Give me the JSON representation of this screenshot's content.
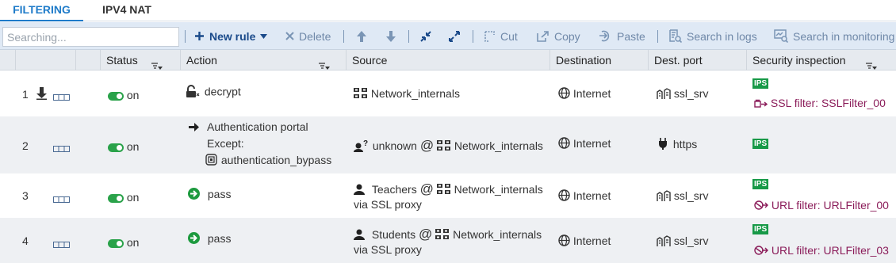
{
  "tabs": [
    {
      "label": "FILTERING",
      "active": true
    },
    {
      "label": "IPV4 NAT",
      "active": false
    }
  ],
  "toolbar": {
    "search_placeholder": "Searching...",
    "new_rule": "New rule",
    "delete": "Delete",
    "cut": "Cut",
    "copy": "Copy",
    "paste": "Paste",
    "search_logs": "Search in logs",
    "search_monitoring": "Search in monitoring"
  },
  "columns": {
    "status": "Status",
    "action": "Action",
    "source": "Source",
    "destination": "Destination",
    "dest_port": "Dest. port",
    "security": "Security inspection"
  },
  "rows": [
    {
      "num": "1",
      "status": "on",
      "action": "decrypt",
      "source_user": "",
      "source_at": "",
      "source": "Network_internals",
      "via": "",
      "destination": "Internet",
      "port": "ssl_srv",
      "ips": "IPS",
      "filter": "SSL filter: SSLFilter_00"
    },
    {
      "num": "2",
      "status": "on",
      "action": "Authentication portal",
      "except_label": "Except:",
      "except_value": "authentication_bypass",
      "source_user": "unknown",
      "source_at": "@",
      "source": "Network_internals",
      "via": "",
      "destination": "Internet",
      "port": "https",
      "ips": "IPS",
      "filter": ""
    },
    {
      "num": "3",
      "status": "on",
      "action": "pass",
      "source_user": "Teachers",
      "source_at": "@",
      "source": "Network_internals",
      "via": "via SSL proxy",
      "destination": "Internet",
      "port": "ssl_srv",
      "ips": "IPS",
      "filter": "URL filter: URLFilter_00"
    },
    {
      "num": "4",
      "status": "on",
      "action": "pass",
      "source_user": "Students",
      "source_at": "@",
      "source": "Network_internals",
      "via": "via SSL proxy",
      "destination": "Internet",
      "port": "ssl_srv",
      "ips": "IPS",
      "filter": "URL filter: URLFilter_03"
    }
  ],
  "colors": {
    "accent": "#1e7bc9",
    "toolbar_bg": "#dfe9f5",
    "on_green": "#2aa24a",
    "ips_green": "#179947",
    "filter_text": "#8b1d5a"
  }
}
